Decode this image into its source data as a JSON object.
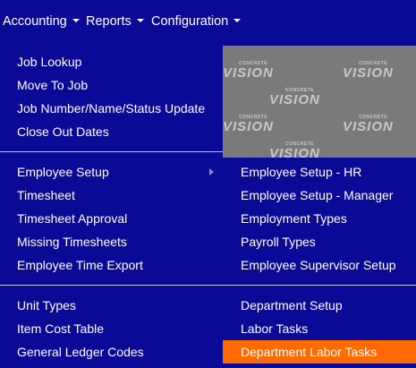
{
  "menubar": {
    "accounting": "Accounting",
    "reports": "Reports",
    "configuration": "Configuration"
  },
  "menu": {
    "group1": [
      "Job Lookup",
      "Move To Job",
      "Job Number/Name/Status Update",
      "Close Out Dates"
    ],
    "group2": [
      "Employee Setup",
      "Timesheet",
      "Timesheet Approval",
      "Missing Timesheets",
      "Employee Time Export"
    ],
    "group3": [
      "Unit Types",
      "Item Cost Table",
      "General Ledger Codes"
    ]
  },
  "submenu": {
    "group1": [
      "Employee Setup - HR",
      "Employee Setup - Manager",
      "Employment Types",
      "Payroll Types",
      "Employee Supervisor Setup"
    ],
    "group2": [
      "Department Setup",
      "Labor Tasks",
      "Department Labor Tasks"
    ]
  },
  "watermark": {
    "small": "CONCRETE",
    "big": "VISION"
  },
  "colors": {
    "menu_bg": "#0a0a96",
    "highlight": "#ff6a00",
    "background_gray": "#7a7a7a"
  }
}
